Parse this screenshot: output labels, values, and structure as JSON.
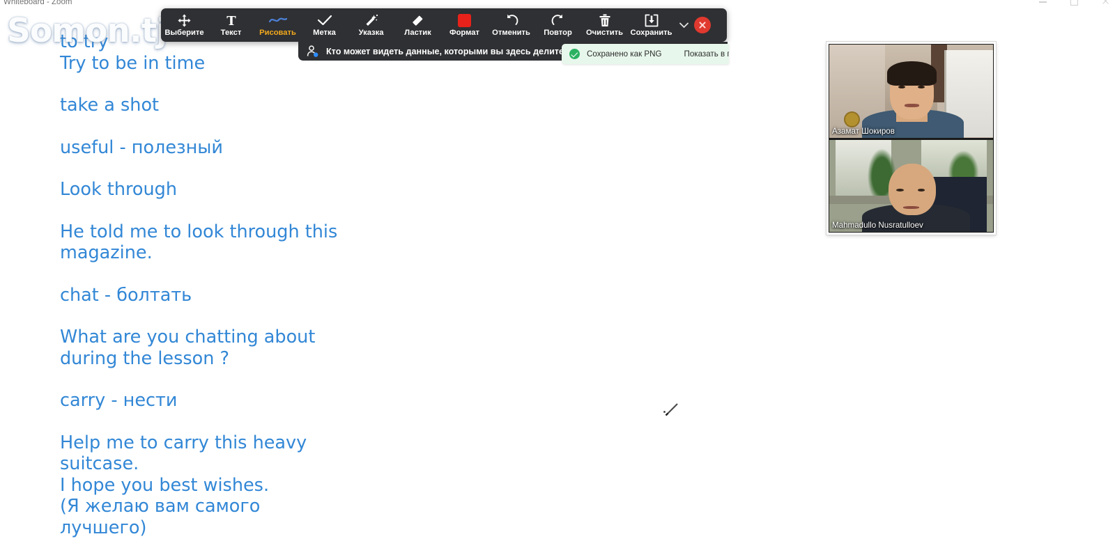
{
  "window": {
    "title": "Whiteboard - Zoom",
    "controls": [
      {
        "name": "minimize",
        "label": "Minimize"
      },
      {
        "name": "maximize",
        "label": "Maximize"
      },
      {
        "name": "close",
        "label": "Close"
      }
    ]
  },
  "watermark": {
    "text": "Somon.tj"
  },
  "toolbar": {
    "tools": [
      {
        "icon": "move-arrows-icon",
        "label": "Выберите",
        "active": false
      },
      {
        "icon": "text-t-icon",
        "label": "Текст",
        "active": false
      },
      {
        "icon": "draw-squiggle-icon",
        "label": "Рисовать",
        "active": true
      },
      {
        "icon": "check-mark-icon",
        "label": "Метка",
        "active": false
      },
      {
        "icon": "magic-wand-icon",
        "label": "Указка",
        "active": false
      },
      {
        "icon": "eraser-icon",
        "label": "Ластик",
        "active": false
      },
      {
        "icon": "color-swatch-icon",
        "label": "Формат",
        "active": false
      },
      {
        "icon": "undo-arrow-icon",
        "label": "Отменить",
        "active": false
      },
      {
        "icon": "redo-arrow-icon",
        "label": "Повтор",
        "active": false
      },
      {
        "icon": "trash-bin-icon",
        "label": "Очистить",
        "active": false
      },
      {
        "icon": "save-download-icon",
        "label": "Сохранить",
        "active": false
      }
    ],
    "format_swatch_color": "#e8211b",
    "active_label_color": "#f2a91c",
    "more_icon": "chevron-down-icon",
    "close_icon": "close-circle-icon"
  },
  "notification": {
    "icon": "person-privacy-icon",
    "text": "Кто может видеть данные, которыми вы здесь делитесь"
  },
  "toast": {
    "icon": "check-circle-icon",
    "message": "Сохранено как PNG",
    "action": "Показать в папке",
    "background": "#e8f7ec",
    "check_color": "#2bb261"
  },
  "whiteboard": {
    "text_color": "#3287d6",
    "cursor_icon": "pen-cursor-icon",
    "lines": [
      {
        "text": "to try",
        "gap": false
      },
      {
        "text": "Try to be in time",
        "gap": false
      },
      {
        "text": "take a shot",
        "gap": true
      },
      {
        "text": "useful - полезный",
        "gap": true
      },
      {
        "text": "Look through",
        "gap": true
      },
      {
        "text": "He told me to look through this",
        "gap": true
      },
      {
        "text": "magazine.",
        "gap": false
      },
      {
        "text": "chat - болтать",
        "gap": true
      },
      {
        "text": "What are you chatting about",
        "gap": true
      },
      {
        "text": "during the lesson ?",
        "gap": false
      },
      {
        "text": "carry - нести",
        "gap": true
      },
      {
        "text": "Help me to carry this heavy",
        "gap": true
      },
      {
        "text": "suitcase.",
        "gap": false
      },
      {
        "text": "I hope you best wishes.",
        "gap": false
      },
      {
        "text": "(Я желаю вам самого",
        "gap": false
      },
      {
        "text": "лучшего)",
        "gap": false
      }
    ]
  },
  "participants": [
    {
      "name": "Азамат Шокиров"
    },
    {
      "name": "Mahmadullo Nusratulloev"
    }
  ]
}
